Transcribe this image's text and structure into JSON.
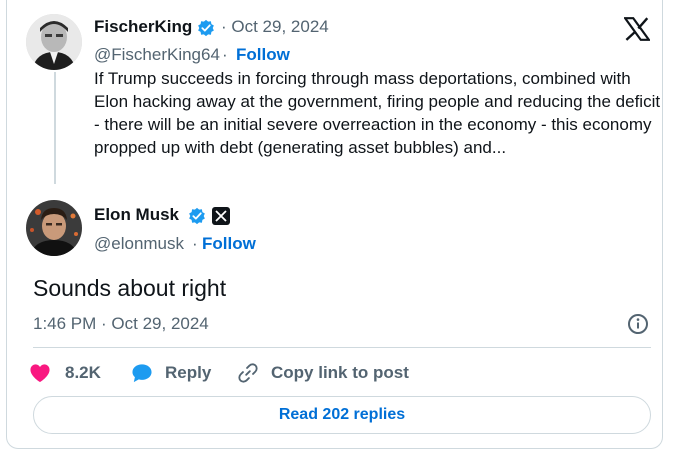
{
  "quoted_tweet": {
    "display_name": "FischerKing",
    "date": "· Oct 29, 2024",
    "handle": "@FischerKing64",
    "separator": "·",
    "follow_label": "Follow",
    "text": "If Trump succeeds in forcing through mass deportations, combined with Elon hacking away at the government, firing people and reducing the deficit - there will be an initial severe overreaction in the economy - this economy propped up with debt (generating asset bubbles) and..."
  },
  "main_tweet": {
    "display_name": "Elon Musk",
    "handle": "@elonmusk",
    "separator": "·",
    "follow_label": "Follow",
    "text": "Sounds about right",
    "timestamp": "1:46 PM · Oct 29, 2024"
  },
  "actions": {
    "likes": "8.2K",
    "reply_label": "Reply",
    "copy_link_label": "Copy link to post"
  },
  "read_replies_label": "Read 202 replies",
  "colors": {
    "accent": "#006fd6",
    "verified": "#1d9bf0",
    "like": "#f91880",
    "muted": "#536471",
    "border": "#cfd9de"
  },
  "icons": [
    "x-logo-icon",
    "verified-badge-icon",
    "x-affiliate-badge-icon",
    "info-icon",
    "heart-icon",
    "reply-bubble-icon",
    "link-icon"
  ]
}
